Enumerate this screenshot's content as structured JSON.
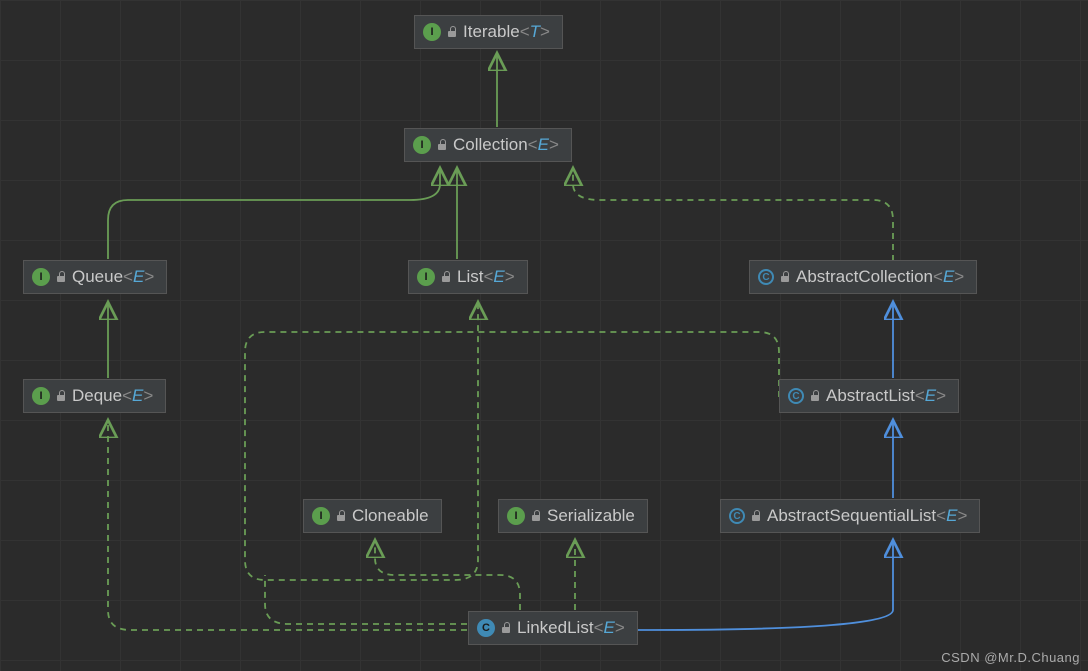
{
  "colors": {
    "bg": "#2b2b2b",
    "grid": "#333333",
    "nodeBg": "#3c3f41",
    "nodeBorder": "#555555",
    "text": "#c9c9c9",
    "generic": "#888888",
    "typeParam": "#56a8d6",
    "interfaceIcon": "#5b9e4d",
    "classIcon": "#3f8ab5",
    "extendsEdge": "#4f8fdc",
    "implementsEdge": "#6a9d56"
  },
  "iconLetters": {
    "interface": "I",
    "class": "C"
  },
  "nodes": {
    "iterable": {
      "kind": "interface",
      "name": "Iterable",
      "typeParam": "T"
    },
    "collection": {
      "kind": "interface",
      "name": "Collection",
      "typeParam": "E"
    },
    "queue": {
      "kind": "interface",
      "name": "Queue",
      "typeParam": "E"
    },
    "list": {
      "kind": "interface",
      "name": "List",
      "typeParam": "E"
    },
    "abscol": {
      "kind": "abstractClass",
      "name": "AbstractCollection",
      "typeParam": "E"
    },
    "deque": {
      "kind": "interface",
      "name": "Deque",
      "typeParam": "E"
    },
    "abslist": {
      "kind": "abstractClass",
      "name": "AbstractList",
      "typeParam": "E"
    },
    "cloneable": {
      "kind": "interface",
      "name": "Cloneable",
      "typeParam": null
    },
    "serializable": {
      "kind": "interface",
      "name": "Serializable",
      "typeParam": null
    },
    "absseqlist": {
      "kind": "abstractClass",
      "name": "AbstractSequentialList",
      "typeParam": "E"
    },
    "linkedlist": {
      "kind": "class",
      "name": "LinkedList",
      "typeParam": "E"
    }
  },
  "edges": [
    {
      "from": "collection",
      "to": "iterable",
      "type": "extends-interface"
    },
    {
      "from": "queue",
      "to": "collection",
      "type": "extends-interface"
    },
    {
      "from": "list",
      "to": "collection",
      "type": "extends-interface"
    },
    {
      "from": "abscol",
      "to": "collection",
      "type": "implements"
    },
    {
      "from": "deque",
      "to": "queue",
      "type": "extends-interface"
    },
    {
      "from": "abslist",
      "to": "abscol",
      "type": "extends-class"
    },
    {
      "from": "abslist",
      "to": "list",
      "type": "implements"
    },
    {
      "from": "absseqlist",
      "to": "abslist",
      "type": "extends-class"
    },
    {
      "from": "linkedlist",
      "to": "absseqlist",
      "type": "extends-class"
    },
    {
      "from": "linkedlist",
      "to": "deque",
      "type": "implements"
    },
    {
      "from": "linkedlist",
      "to": "cloneable",
      "type": "implements"
    },
    {
      "from": "linkedlist",
      "to": "serializable",
      "type": "implements"
    },
    {
      "from": "linkedlist",
      "to": "list",
      "type": "implements"
    }
  ],
  "watermark": "CSDN @Mr.D.Chuang"
}
